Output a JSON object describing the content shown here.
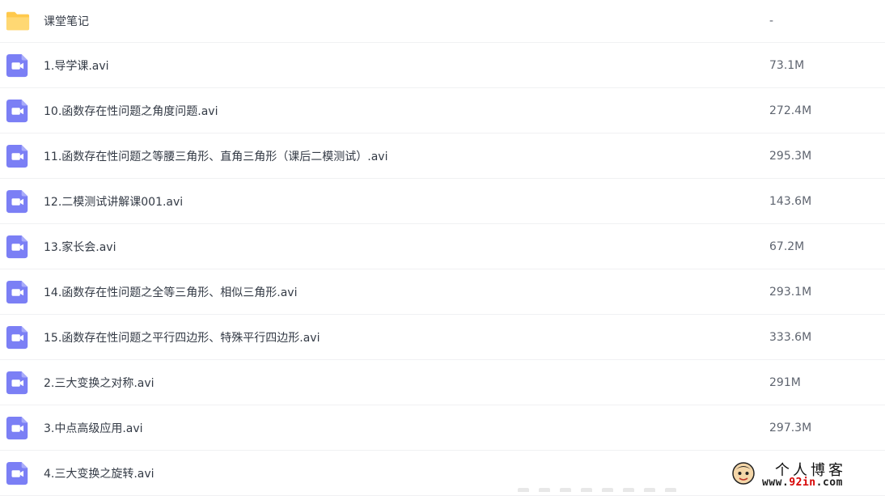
{
  "files": [
    {
      "name": "课堂笔记",
      "size": "-",
      "type": "folder"
    },
    {
      "name": "1.导学课.avi",
      "size": "73.1M",
      "type": "video"
    },
    {
      "name": "10.函数存在性问题之角度问题.avi",
      "size": "272.4M",
      "type": "video"
    },
    {
      "name": "11.函数存在性问题之等腰三角形、直角三角形（课后二模测试）.avi",
      "size": "295.3M",
      "type": "video"
    },
    {
      "name": "12.二模测试讲解课001.avi",
      "size": "143.6M",
      "type": "video"
    },
    {
      "name": "13.家长会.avi",
      "size": "67.2M",
      "type": "video"
    },
    {
      "name": "14.函数存在性问题之全等三角形、相似三角形.avi",
      "size": "293.1M",
      "type": "video"
    },
    {
      "name": "15.函数存在性问题之平行四边形、特殊平行四边形.avi",
      "size": "333.6M",
      "type": "video"
    },
    {
      "name": "2.三大变换之对称.avi",
      "size": "291M",
      "type": "video"
    },
    {
      "name": "3.中点高级应用.avi",
      "size": "297.3M",
      "type": "video"
    },
    {
      "name": "4.三大变换之旋转.avi",
      "size": "",
      "type": "video"
    }
  ],
  "icons": {
    "folder": "folder-icon",
    "video": "video-file-icon"
  },
  "colors": {
    "folder": "#ffc94c",
    "video": "#7b7ff5"
  },
  "watermark": {
    "title": "个人博客",
    "url_prefix": "www.",
    "url_highlight": "92in",
    "url_suffix": ".com"
  }
}
